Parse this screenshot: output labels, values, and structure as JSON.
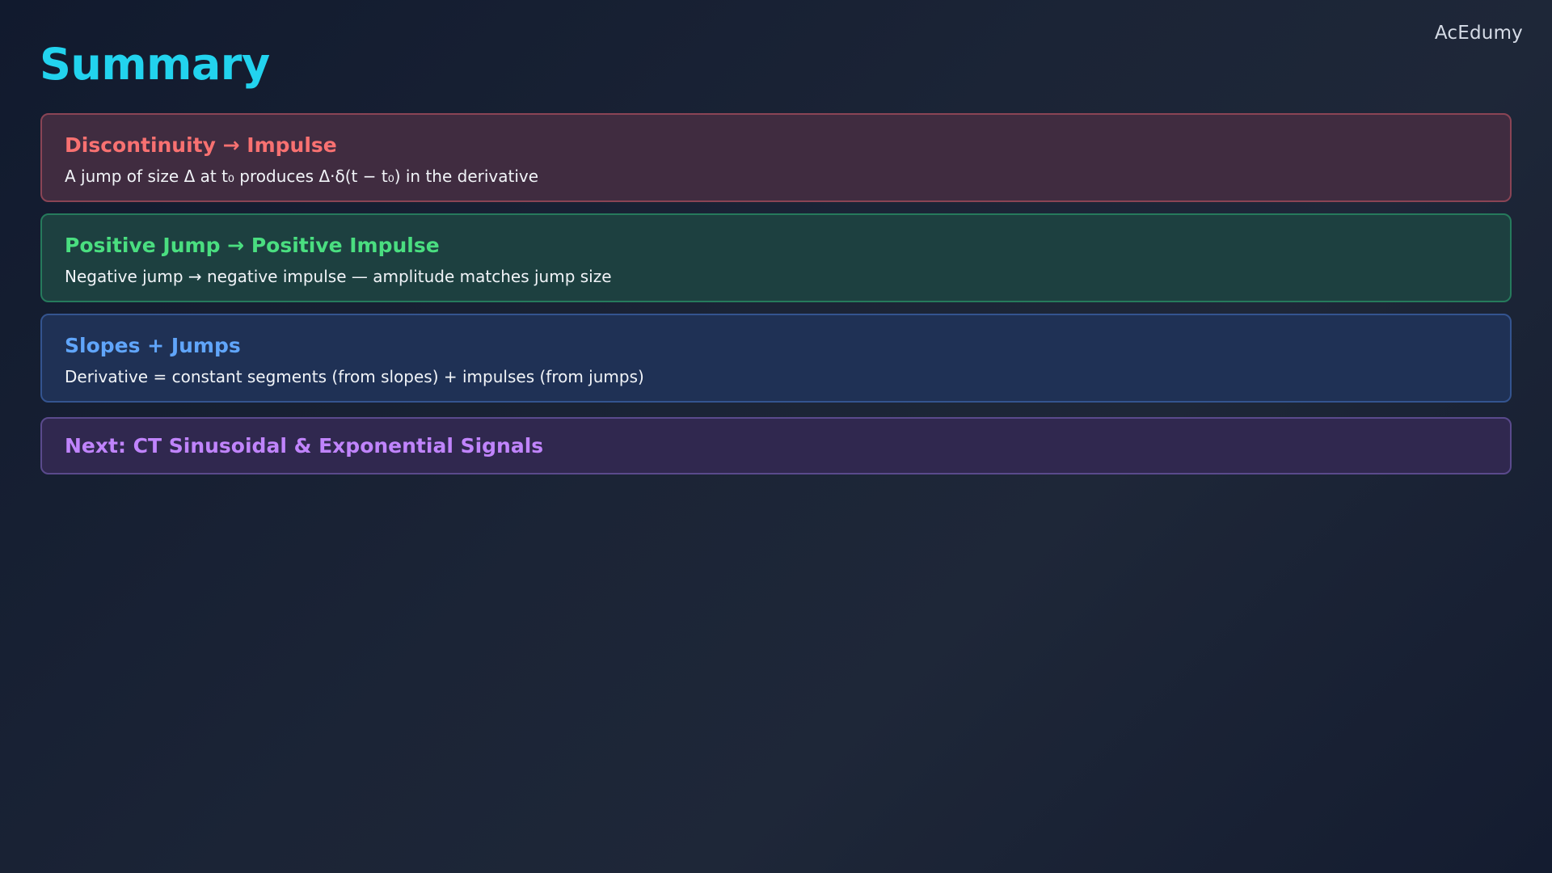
{
  "brand": "AcEdumy",
  "title": "Summary",
  "cards": [
    {
      "title": "Discontinuity → Impulse",
      "desc": "A jump of size Δ at t₀ produces Δ·δ(t − t₀) in the derivative",
      "color": "#f87171"
    },
    {
      "title": "Positive Jump → Positive Impulse",
      "desc": "Negative jump → negative impulse — amplitude matches jump size",
      "color": "#4ade80"
    },
    {
      "title": "Slopes + Jumps",
      "desc": "Derivative = constant segments (from slopes) + impulses (from jumps)",
      "color": "#60a5fa"
    },
    {
      "title": "Next: CT Sinusoidal & Exponential Signals",
      "color": "#c084fc"
    }
  ]
}
